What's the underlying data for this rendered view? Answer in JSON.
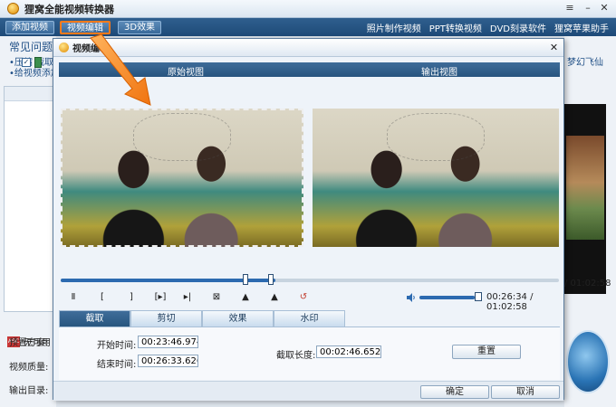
{
  "app": {
    "title": "狸窝全能视频转换器",
    "toolbar": {
      "add_video": "添加视频",
      "edit_video": "视频编辑",
      "effect_3d": "3D效果",
      "links": [
        "照片制作视频",
        "PPT转换视频",
        "DVD刻录软件",
        "狸窝苹果助手"
      ]
    },
    "window_controls": [
      "≡",
      "–",
      "✕"
    ]
  },
  "left_panel": {
    "faq_title": "常见问题",
    "faq_lines": [
      "•压缩  截取",
      "•给视频添加"
    ],
    "subtitle_label": "无可用",
    "fields": [
      "预置方案:",
      "视频质量:",
      "输出目录:"
    ]
  },
  "right_panel": {
    "text": "梦幻飞仙",
    "time": "/ 01:02:58"
  },
  "dialog": {
    "title": "视频编辑",
    "original_view": "原始视图",
    "output_view": "输出视图",
    "controls": [
      "Ⅱ",
      "[",
      "]",
      "[▸]",
      "▸|",
      "⊠",
      "▲",
      "▲",
      "↺"
    ],
    "time_readout": "00:26:34 / 01:02:58",
    "seek": {
      "progress": 0.431,
      "mark_in": 0.371,
      "mark_out": 0.422
    },
    "volume": {
      "level": 0.9
    },
    "tabs": [
      "截取",
      "剪切",
      "效果",
      "水印"
    ],
    "selected_tab": 0,
    "start_time_label": "开始时间:",
    "start_time": "00:23:46.974",
    "end_time_label": "结束时间:",
    "end_time": "00:26:33.626",
    "duration_label": "截取长度:",
    "duration": "00:02:46.652",
    "reset": "重置",
    "ok": "确定",
    "cancel": "取消"
  },
  "colors": {
    "accent": "#2c6ab0",
    "toolbar": "#1e4a78",
    "highlight": "#ff7a1a"
  }
}
